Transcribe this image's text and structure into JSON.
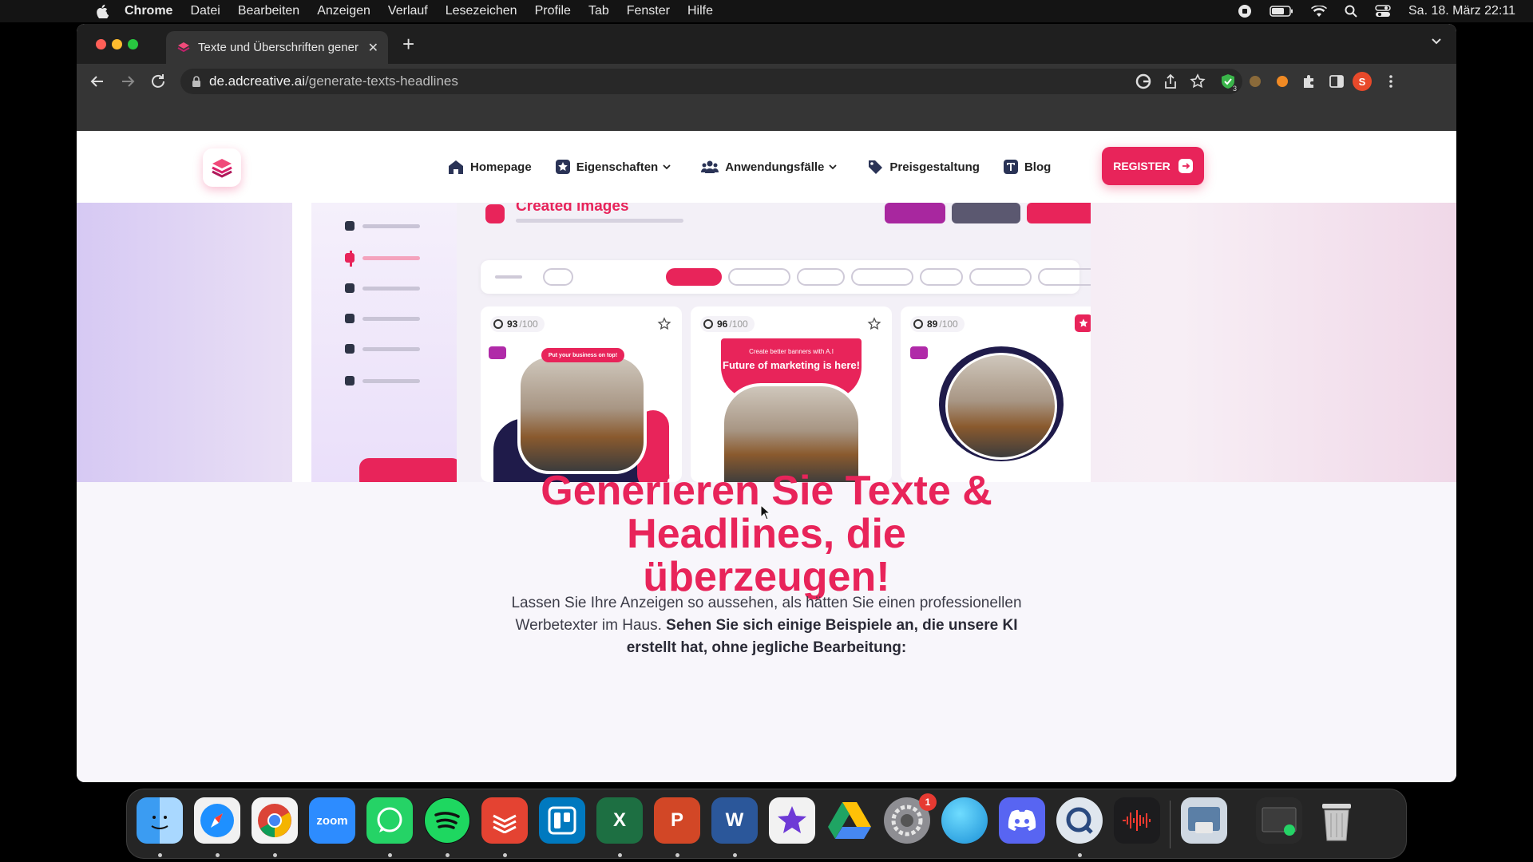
{
  "menubar": {
    "items": [
      "Chrome",
      "Datei",
      "Bearbeiten",
      "Anzeigen",
      "Verlauf",
      "Lesezeichen",
      "Profile",
      "Tab",
      "Fenster",
      "Hilfe"
    ],
    "clock": "Sa. 18. März  22:11"
  },
  "browser": {
    "tab_title": "Texte und Überschriften gener",
    "url_domain": "de.adcreative.ai",
    "url_path": "/generate-texts-headlines",
    "profile_initial": "S",
    "extension_badge": "3"
  },
  "site": {
    "nav": [
      {
        "label": "Homepage",
        "icon": "home-icon"
      },
      {
        "label": "Eigenschaften",
        "icon": "star-badge-icon",
        "dropdown": true
      },
      {
        "label": "Anwendungsfälle",
        "icon": "users-icon",
        "dropdown": true
      },
      {
        "label": "Preisgestaltung",
        "icon": "price-tag-icon"
      },
      {
        "label": "Blog",
        "icon": "blog-t-icon"
      }
    ],
    "register_label": "REGISTER"
  },
  "mockup": {
    "title": "Created images",
    "cards": [
      {
        "score": "93",
        "denominator": "/100",
        "favorited": false,
        "banner": "Put your business on top!"
      },
      {
        "score": "96",
        "denominator": "/100",
        "favorited": false,
        "banner_line1": "Create better banners with A.I",
        "banner_line2": "Future of marketing is here!"
      },
      {
        "score": "89",
        "denominator": "/100",
        "favorited": true
      }
    ]
  },
  "hero": {
    "title_lines": [
      "Generieren Sie Texte &",
      "Headlines, die",
      "überzeugen!"
    ],
    "subtitle_plain": "Lassen Sie Ihre Anzeigen so aussehen, als hätten Sie einen professionellen Werbetexter im Haus.",
    "subtitle_bold": "Sehen Sie sich einige Beispiele an, die unsere KI erstellt hat, ohne jegliche Bearbeitung:"
  },
  "dock": {
    "apps": [
      "Finder",
      "Safari",
      "Chrome",
      "Zoom",
      "WhatsApp",
      "Spotify",
      "Todoist",
      "Trello",
      "Excel",
      "PowerPoint",
      "Word",
      "iMovie",
      "Google Drive",
      "Systemeinstellungen",
      "Safari Blue",
      "Discord",
      "QuickTime",
      "Voice Memos",
      "Preview",
      "Screenshot",
      "Papierkorb"
    ],
    "zoom_label": "zoom",
    "settings_badge": "1"
  },
  "colors": {
    "accent": "#e8245a",
    "purple": "#b02aa8"
  }
}
